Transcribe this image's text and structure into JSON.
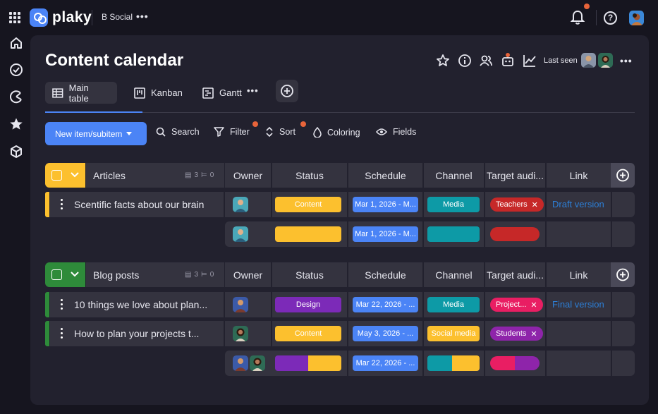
{
  "app": {
    "logo_text": "plaky",
    "workspace": "B Social"
  },
  "page": {
    "title": "Content calendar",
    "last_seen_label": "Last seen"
  },
  "tabs": [
    {
      "label": "Main table",
      "icon": "table-icon",
      "active": true
    },
    {
      "label": "Kanban",
      "icon": "kanban-icon",
      "active": false
    },
    {
      "label": "Gantt",
      "icon": "gantt-icon",
      "active": false
    }
  ],
  "toolbar": {
    "new_item": "New item/subitem",
    "search": "Search",
    "filter": "Filter",
    "sort": "Sort",
    "coloring": "Coloring",
    "fields": "Fields"
  },
  "columns": [
    "Owner",
    "Status",
    "Schedule",
    "Channel",
    "Target audi...",
    "Link"
  ],
  "colors": {
    "accent": "#4b84f6",
    "content": "#fcc02e",
    "design": "#7c2ab8",
    "media": "#0d9aa6",
    "social_media": "#fcc02e",
    "teachers": "#c62828",
    "project": "#e91e63",
    "students": "#8e24aa",
    "articles_group": "#fcc02e",
    "blog_group": "#2e8b3a",
    "link": "#2d7fd6",
    "notification_dot": "#e8643a"
  },
  "groups": [
    {
      "name": "Articles",
      "count_items": "3",
      "count_subitems": "0",
      "rows": [
        {
          "name": "Scentific facts about our brain",
          "status": "Content",
          "schedule": "Mar 1, 2026 - M...",
          "channel": "Media",
          "audience": "Teachers",
          "link": "Draft version"
        }
      ],
      "summary": {
        "schedule": "Mar 1, 2026 - M..."
      }
    },
    {
      "name": "Blog posts",
      "count_items": "3",
      "count_subitems": "0",
      "rows": [
        {
          "name": "10 things we love about plan...",
          "status": "Design",
          "schedule": "Mar 22, 2026 - ...",
          "channel": "Media",
          "audience": "Project...",
          "link": "Final version"
        },
        {
          "name": "How to plan your projects t...",
          "status": "Content",
          "schedule": "May 3, 2026 - ...",
          "channel": "Social media",
          "audience": "Students",
          "link": ""
        }
      ],
      "summary": {
        "schedule": "Mar 22, 2026 - ..."
      }
    }
  ]
}
